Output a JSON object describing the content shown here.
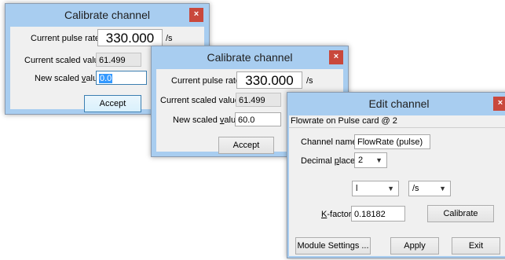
{
  "cal1": {
    "title": "Calibrate channel",
    "close": "×",
    "pulse_label": "Current pulse rate",
    "pulse_value": "330.000",
    "pulse_unit": "/s",
    "scaled_label": "Current scaled value",
    "scaled_value": "61.499",
    "new_label_pre": "New scaled ",
    "new_label_u": "v",
    "new_label_post": "alue",
    "new_value": "0.0",
    "accept": "Accept"
  },
  "cal2": {
    "title": "Calibrate channel",
    "close": "×",
    "pulse_label": "Current pulse rate",
    "pulse_value": "330.000",
    "pulse_unit": "/s",
    "scaled_label": "Current scaled value",
    "scaled_value": "61.499",
    "new_label_pre": "New scaled ",
    "new_label_u": "v",
    "new_label_post": "alue",
    "new_value": "60.0",
    "accept": "Accept"
  },
  "edit": {
    "title": "Edit channel",
    "close": "×",
    "header": "Flowrate on Pulse card @ 2",
    "channel_name_label": "Channel name",
    "channel_name_value": "FlowRate (pulse)",
    "decimal_label_pre": "Decimal ",
    "decimal_label_u": "p",
    "decimal_label_post": "laces",
    "decimal_value": "2",
    "unit_value": "l",
    "rate_value": "/s",
    "kfactor_label_u": "K",
    "kfactor_label_post": "-factor",
    "kfactor_value": "0.18182",
    "calibrate": "Calibrate",
    "module_settings": "Module Settings ...",
    "apply": "Apply",
    "exit": "Exit",
    "dropdown_arrow": "▼"
  }
}
